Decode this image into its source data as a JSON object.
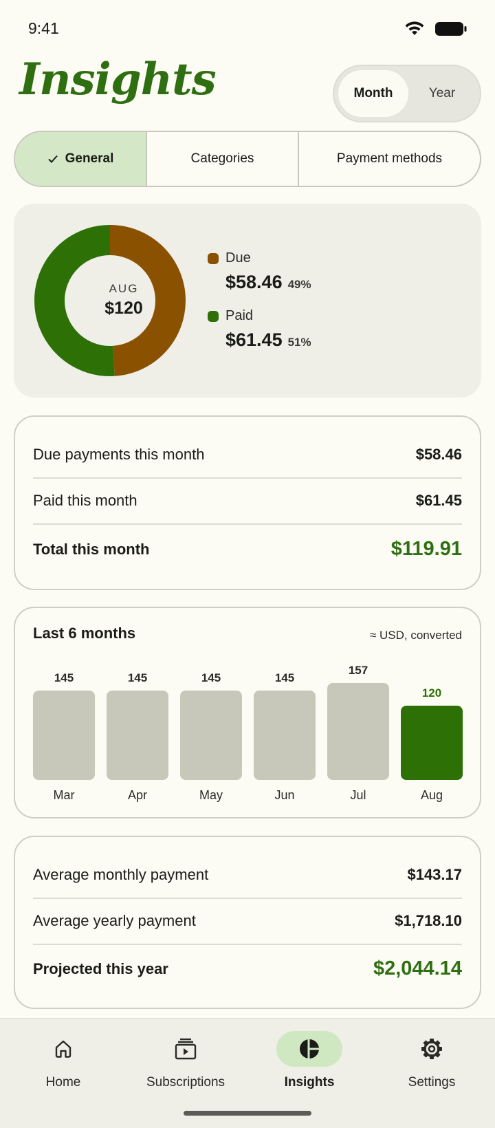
{
  "status_bar": {
    "time": "9:41"
  },
  "header": {
    "title": "Insights"
  },
  "period_toggle": {
    "options": [
      "Month",
      "Year"
    ],
    "selected": "Month"
  },
  "tabs": [
    {
      "label": "General",
      "selected": true
    },
    {
      "label": "Categories",
      "selected": false
    },
    {
      "label": "Payment methods",
      "selected": false
    }
  ],
  "donut": {
    "month": "AUG",
    "total": "$120",
    "segments": [
      {
        "name": "Due",
        "amount": "$58.46",
        "percent": "49%",
        "fraction": 0.49,
        "color": "#8a5200"
      },
      {
        "name": "Paid",
        "amount": "$61.45",
        "percent": "51%",
        "fraction": 0.51,
        "color": "#2d7006"
      }
    ]
  },
  "monthly_summary": {
    "rows": [
      {
        "label": "Due payments this month",
        "value": "$58.46"
      },
      {
        "label": "Paid this month",
        "value": "$61.45"
      },
      {
        "label": "Total this month",
        "value": "$119.91"
      }
    ]
  },
  "chart_data": {
    "type": "bar",
    "title": "Last 6 months",
    "note": "≈ USD, converted",
    "categories": [
      "Mar",
      "Apr",
      "May",
      "Jun",
      "Jul",
      "Aug"
    ],
    "values": [
      145,
      145,
      145,
      145,
      157,
      120
    ],
    "highlight_index": 5,
    "colors": {
      "default": "#c8c8ba",
      "highlight": "#2d7006"
    }
  },
  "averages": {
    "rows": [
      {
        "label": "Average monthly payment",
        "value": "$143.17"
      },
      {
        "label": "Average yearly payment",
        "value": "$1,718.10"
      },
      {
        "label": "Projected this year",
        "value": "$2,044.14"
      }
    ]
  },
  "bottom_nav": {
    "items": [
      {
        "label": "Home",
        "icon": "home-icon"
      },
      {
        "label": "Subscriptions",
        "icon": "subscriptions-icon"
      },
      {
        "label": "Insights",
        "icon": "insights-icon",
        "active": true
      },
      {
        "label": "Settings",
        "icon": "gear-icon"
      }
    ]
  },
  "colors": {
    "accent_green": "#2f6f12",
    "due_brown": "#8a5200",
    "selected_tab_bg": "#d4e8c8"
  }
}
